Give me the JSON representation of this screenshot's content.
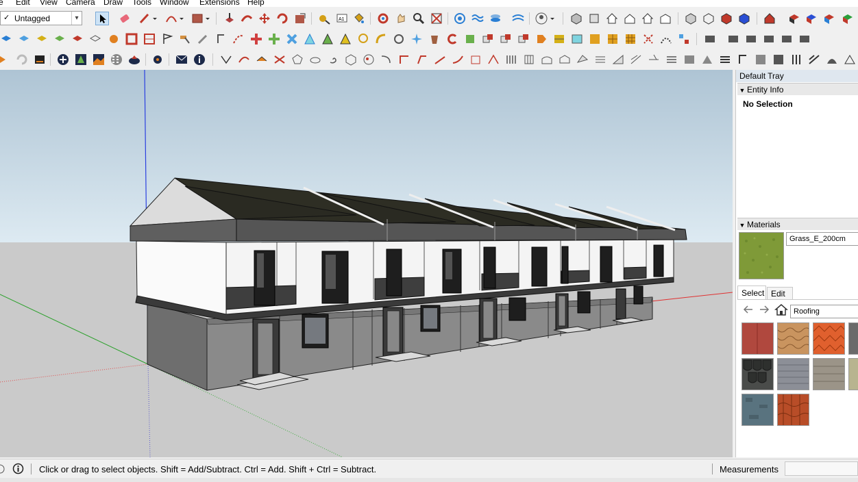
{
  "menu": [
    "e",
    "Edit",
    "View",
    "Camera",
    "Draw",
    "Tools",
    "Window",
    "Extensions",
    "Help"
  ],
  "tag_selector": {
    "check": "✓",
    "value": "Untagged"
  },
  "tray": {
    "title": "Default Tray",
    "entity_info": {
      "header": "Entity Info",
      "selection": "No Selection"
    },
    "materials": {
      "header": "Materials",
      "current_material": "Grass_E_200cm",
      "current_color": "#7f9a38",
      "tabs": [
        "Select",
        "Edit"
      ],
      "library": "Roofing",
      "swatch_colors": [
        [
          "#b0483e",
          "#c9945f",
          "#e0602e",
          "#6a6a6a"
        ],
        [
          "#3d3f3d",
          "#8c8f97",
          "#9b9488",
          "#b8b48f"
        ],
        [
          "#59737f",
          "#b84d28"
        ]
      ]
    }
  },
  "status": {
    "message": "Click or drag to select objects. Shift = Add/Subtract. Ctrl = Add. Shift + Ctrl = Subtract.",
    "measurements_label": "Measurements",
    "measurements_value": ""
  }
}
